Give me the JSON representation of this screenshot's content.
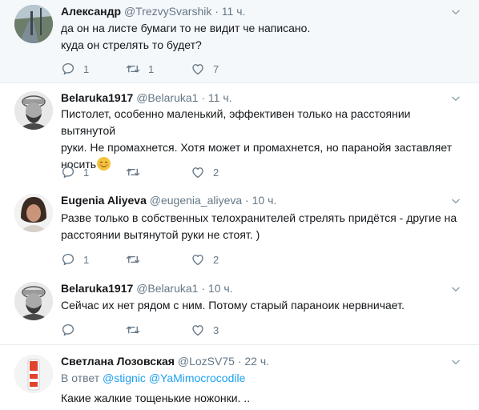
{
  "tweets": [
    {
      "name": "Александр",
      "handle": "@TrezvySvarshik",
      "dot": "·",
      "time": "11 ч.",
      "lines": [
        "да он на листе бумаги то не видит че написано.",
        "куда он стрелять то будет?"
      ],
      "replies": "1",
      "retweets": "1",
      "likes": "7"
    },
    {
      "name": "Belaruka1917",
      "handle": "@Belaruka1",
      "dot": "·",
      "time": "11 ч.",
      "lines": [
        "Пистолет, особенно маленький, эффективен только на расстоянии вытянутой",
        "руки. Не промахнется. Хотя может и промахнется, но паранойя заставляет",
        "носить"
      ],
      "emoji": "relieved-face-emoji",
      "replies": "1",
      "retweets": "",
      "likes": "2"
    },
    {
      "name": "Eugenia Aliyeva",
      "handle": "@eugenia_aliyeva",
      "dot": "·",
      "time": "10 ч.",
      "lines": [
        "Разве только в собственных телохранителей стрелять придётся - другие на",
        "расстоянии вытянутой руки не стоят. )"
      ],
      "replies": "1",
      "retweets": "",
      "likes": "2"
    },
    {
      "name": "Belaruka1917",
      "handle": "@Belaruka1",
      "dot": "·",
      "time": "10 ч.",
      "lines": [
        "Сейчас их нет рядом с ним. Потому старый параноик нервничает."
      ],
      "replies": "",
      "retweets": "",
      "likes": "3"
    },
    {
      "name": "Светлана Лозовская",
      "handle": "@LozSV75",
      "dot": "·",
      "time": "22 ч.",
      "reply_prefix": "В ответ",
      "mentions": [
        "@stignic",
        "@YaMimocrocodile"
      ],
      "lines": [
        "Какие жалкие тощенькие ножонки. .."
      ]
    }
  ],
  "icons": {
    "reply": "reply-icon",
    "retweet": "retweet-icon",
    "like": "heart-icon",
    "caret": "chevron-down-icon"
  },
  "colors": {
    "secondary_text": "#657786",
    "link": "#1da1f2",
    "highlight_bg": "#f5f8fa",
    "divider": "#e6ecf0"
  }
}
